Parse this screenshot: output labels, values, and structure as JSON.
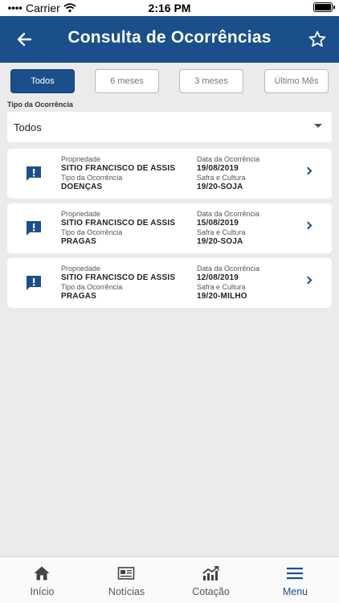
{
  "status_bar": {
    "carrier": "Carrier",
    "time": "2:16 PM"
  },
  "header": {
    "title": "Consulta de Ocorrências"
  },
  "filters": [
    {
      "label": "Todos",
      "active": true
    },
    {
      "label": "6 meses",
      "active": false
    },
    {
      "label": "3 meses",
      "active": false
    },
    {
      "label": "Último Mês",
      "active": false
    }
  ],
  "type_filter": {
    "label": "Tipo da Ocorrência",
    "value": "Todos"
  },
  "field_labels": {
    "property": "Propriedade",
    "type": "Tipo da Ocorrência",
    "date": "Data da Ocorrência",
    "harvest": "Safra e Cultura"
  },
  "occurrences": [
    {
      "property": "SITIO FRANCISCO DE ASSIS",
      "type": "DOENÇAS",
      "date": "19/08/2019",
      "harvest": "19/20-SOJA"
    },
    {
      "property": "SITIO FRANCISCO DE ASSIS",
      "type": "PRAGAS",
      "date": "15/08/2019",
      "harvest": "19/20-SOJA"
    },
    {
      "property": "SITIO FRANCISCO DE ASSIS",
      "type": "PRAGAS",
      "date": "12/08/2019",
      "harvest": "19/20-MILHO"
    }
  ],
  "tabs": [
    {
      "label": "Início",
      "icon": "home-icon"
    },
    {
      "label": "Notícias",
      "icon": "newspaper-icon"
    },
    {
      "label": "Cotação",
      "icon": "chart-icon"
    },
    {
      "label": "Menu",
      "icon": "menu-icon",
      "active": true
    }
  ],
  "colors": {
    "primary": "#1a4f8c",
    "background": "#ebebeb"
  }
}
